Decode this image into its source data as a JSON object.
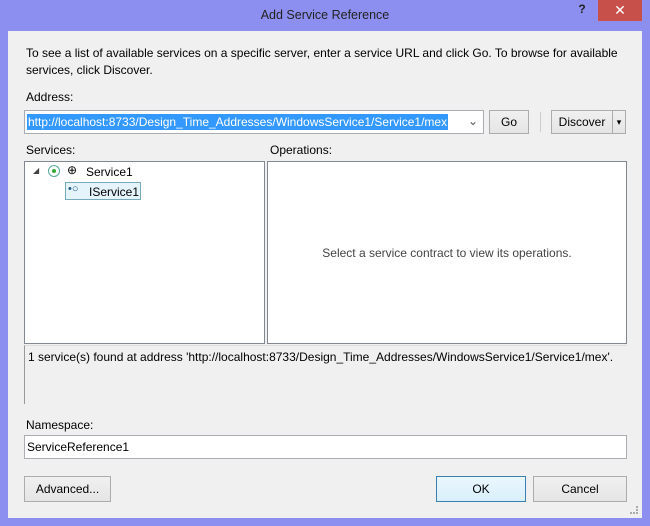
{
  "window": {
    "title": "Add Service Reference",
    "help": "?",
    "close": "✕"
  },
  "description": "To see a list of available services on a specific server, enter a service URL and click Go. To browse for available services, click Discover.",
  "address": {
    "label": "Address:",
    "value": "http://localhost:8733/Design_Time_Addresses/WindowsService1/Service1/mex",
    "dropdown": "⌄"
  },
  "buttons": {
    "go": "Go",
    "discover": "Discover",
    "discover_arrow": "▾",
    "advanced": "Advanced...",
    "ok": "OK",
    "cancel": "Cancel"
  },
  "services": {
    "label": "Services:",
    "tree": [
      {
        "label": "Service1",
        "expander": "◢"
      },
      {
        "label": "IService1"
      }
    ]
  },
  "operations": {
    "label": "Operations:",
    "placeholder": "Select a service contract to view its operations."
  },
  "status": "1 service(s) found at address 'http://localhost:8733/Design_Time_Addresses/WindowsService1/Service1/mex'.",
  "namespace": {
    "label": "Namespace:",
    "value": "ServiceReference1"
  }
}
